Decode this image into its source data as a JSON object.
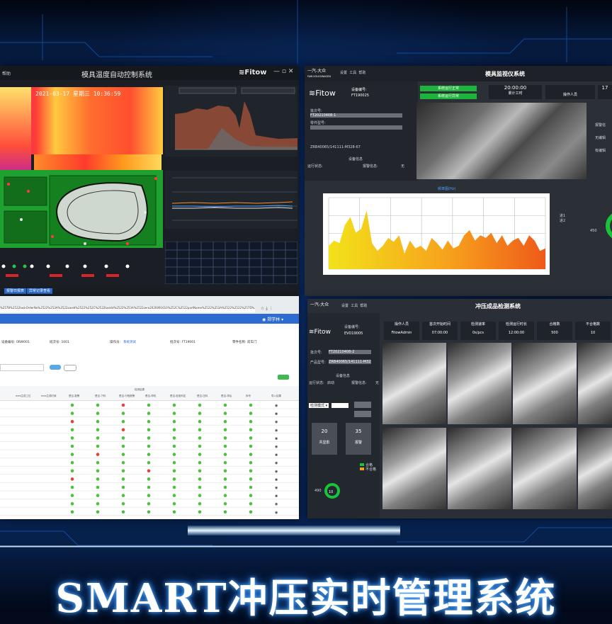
{
  "hero_title": "SMART冲压实时管理系统",
  "panel1": {
    "title": "模具温度自动控制系统",
    "help": "帮助",
    "brand": "Fitow",
    "datetime": "2021-03-17 星期三 10:36:59",
    "buttons": [
      "报警日报表",
      "异常记录查看"
    ]
  },
  "panel2": {
    "brand_cn": "一汽-大众",
    "brand_en": "FAW-VOLKSWAGEN",
    "menu": [
      "设置",
      "工具",
      "帮助"
    ],
    "title": "模具监视仪系统",
    "brand": "Fitow",
    "device_label": "设备编号:",
    "device_id": "FT190025",
    "batch_label": "批次号:",
    "batch_value": "FT20210408-1",
    "part_label": "零件型号:",
    "part_value": "ZRB40065/141111-M328-67",
    "status_buttons": [
      "系统运行正常",
      "系统运行异常"
    ],
    "time": "20:00:00",
    "time_label": "累计工时",
    "operator_label": "操作人员",
    "device_info": "设备信息",
    "run_status": "运行状态:",
    "alarm_info": "报警信息:",
    "alarm_value": "无",
    "right_labels": [
      "报警信",
      "无编辑",
      "有编辑"
    ],
    "chart_caption": "频率图(Hz)",
    "legend": [
      "进1",
      "进2"
    ],
    "gauge_label": "450"
  },
  "panel3": {
    "url": "%257B%2522taskOrderNo%2522%253A%2522zaoId%2522%252C%2522taskId%2522%253A%2522zero2020091610%252C%2522partName%2522%253A%2522%2522%257D%2520",
    "user": "郑学林",
    "info": [
      "设备编号: 0RW001",
      "班次号: 1001",
      "操作员:",
      "系统测试",
      "批次号: FT19001",
      "零件名称: 前车门"
    ],
    "columns": [
      "mes生成工位",
      "mes生成时间",
      "是否-报警",
      "是否-下料",
      "是否-行程报警",
      "是否-停机",
      "是否-检测判定",
      "是否-压料",
      "是否-滞后",
      "序号",
      "导入结果"
    ],
    "col_group": "检测结果"
  },
  "panel4": {
    "brand_cn": "一汽-大众",
    "menu": [
      "设置",
      "工具",
      "帮助"
    ],
    "title": "冲压成品检测系统",
    "brand": "Fitow",
    "device_label": "设备编号:",
    "device_id": "EVO19005",
    "stats": [
      {
        "label": "操作人员",
        "value": "FitowAdmin"
      },
      {
        "label": "首次开始时间",
        "value": "07:00:00"
      },
      {
        "label": "检测速率",
        "value": "0s/pcs"
      },
      {
        "label": "检测运行时长",
        "value": "12:00:00"
      },
      {
        "label": "合格数",
        "value": "500"
      },
      {
        "label": "不合格数",
        "value": "10"
      }
    ],
    "batch_label": "批次号:",
    "batch_value": "FT20210408-2",
    "part_label": "产品型号:",
    "part_value": "ZRB40065/141111-M328",
    "device_info": "设备信息",
    "run_status": "运行状态:",
    "run_value": "启动",
    "alarm_info": "报警信息:",
    "alarm_value": "无",
    "mode_label": "检测模式",
    "boxes": [
      {
        "value": "20",
        "label": "共显影"
      },
      {
        "value": "35",
        "label": "报警"
      }
    ],
    "legend": [
      "合格",
      "不合格"
    ],
    "gauge_label": "490",
    "gauge_value": "10"
  },
  "chart_data": [
    {
      "type": "area",
      "title": "",
      "x": [
        0,
        1,
        2,
        3,
        4,
        5,
        6,
        7,
        8,
        9,
        10,
        11,
        12,
        13,
        14,
        15,
        16,
        17,
        18,
        19,
        20,
        21,
        22,
        23,
        24,
        25,
        26,
        27,
        28,
        29,
        30,
        31,
        32,
        33,
        34,
        35,
        36,
        37,
        38,
        39,
        40
      ],
      "values": [
        18,
        22,
        20,
        34,
        40,
        28,
        31,
        45,
        20,
        14,
        18,
        24,
        21,
        26,
        12,
        22,
        16,
        18,
        14,
        24,
        20,
        15,
        22,
        16,
        18,
        26,
        30,
        22,
        26,
        24,
        28,
        20,
        26,
        18,
        22,
        24,
        18,
        26,
        22,
        14,
        16
      ],
      "ylim": [
        0,
        55
      ]
    }
  ]
}
